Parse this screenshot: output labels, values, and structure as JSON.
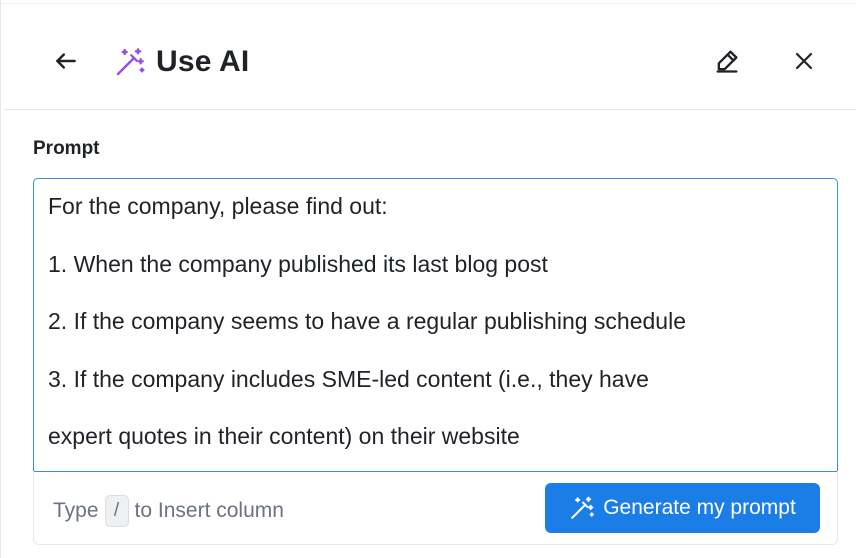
{
  "header": {
    "title": "Use AI",
    "back_icon": "arrow-left-icon",
    "title_icon": "magic-wand-sparkles-icon",
    "edit_icon": "eraser-pen-icon",
    "close_icon": "close-icon"
  },
  "prompt": {
    "label": "Prompt",
    "lines": [
      "For the company, please find out:",
      "1. When the company published its last blog post",
      "2. If the company seems to have a regular publishing schedule",
      "3. If the company includes SME-led content (i.e., they have",
      "expert quotes in their content) on their website"
    ]
  },
  "footer": {
    "hint_prefix": "Type",
    "hint_key": "/",
    "hint_suffix": "to Insert column",
    "generate_label": "Generate my prompt",
    "generate_icon": "magic-wand-sparkles-icon"
  },
  "colors": {
    "accent": "#1a7ee6",
    "title_icon": "#9b4de0",
    "focus_border": "#3b8fe0"
  }
}
